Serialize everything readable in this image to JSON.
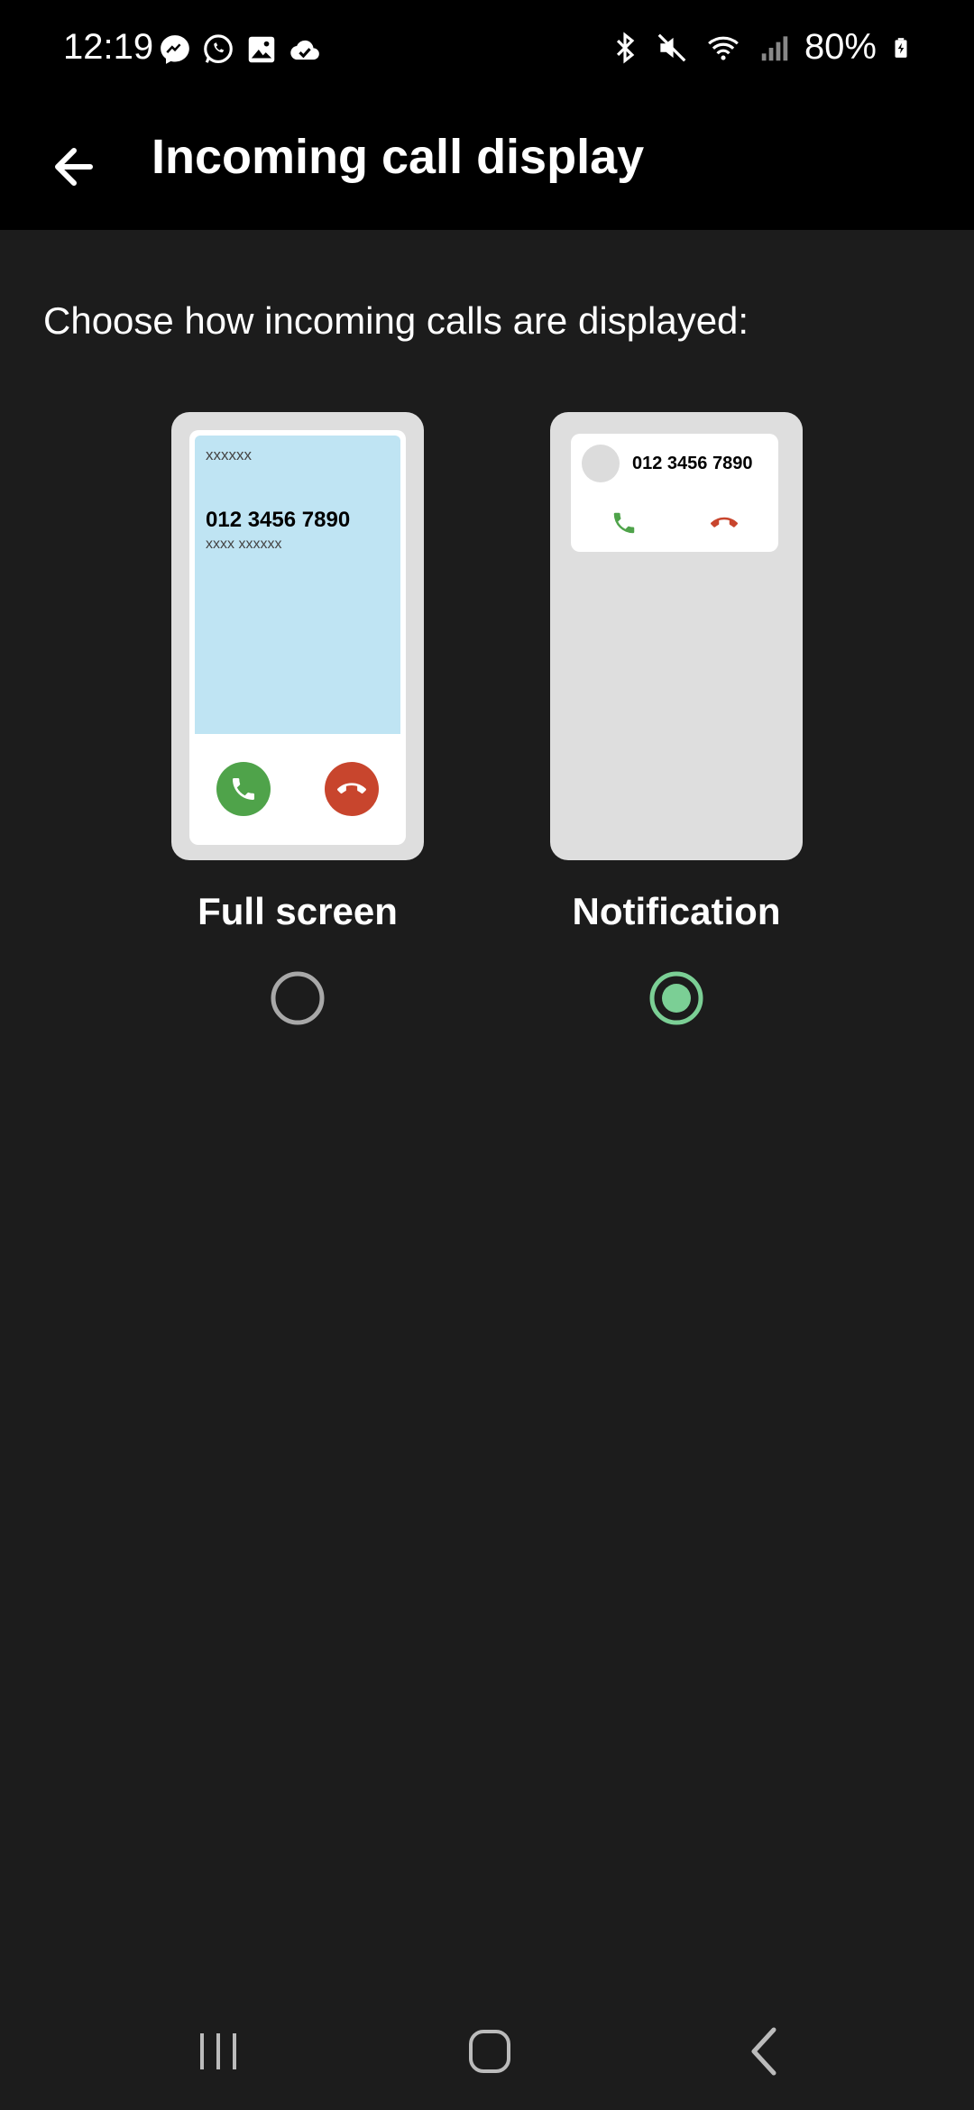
{
  "status_bar": {
    "time": "12:19",
    "battery": "80%",
    "left_icons": [
      "messenger-icon",
      "whatsapp-icon",
      "gallery-icon",
      "cloud-check-icon"
    ],
    "right_icons": [
      "bluetooth-icon",
      "mute-icon",
      "wifi-icon",
      "signal-icon",
      "battery-charging-icon"
    ]
  },
  "app_bar": {
    "title": "Incoming call display",
    "back_icon": "arrow-left-icon"
  },
  "subtitle": "Choose how incoming calls are displayed:",
  "options": [
    {
      "label": "Full screen",
      "selected": false,
      "preview": {
        "caller_name": "xxxxxx",
        "number": "012 3456 7890",
        "caller_label": "xxxx xxxxxx"
      }
    },
    {
      "label": "Notification",
      "selected": true,
      "preview": {
        "number": "012 3456 7890"
      }
    }
  ],
  "colors": {
    "background": "#1c1c1c",
    "accent_green": "#7bcf95",
    "accept_green": "#4fa34a",
    "decline_red": "#c8452d",
    "preview_blue": "#bfe4f3"
  },
  "nav_bar": {
    "buttons": [
      "recent-apps-icon",
      "home-icon",
      "back-icon"
    ]
  }
}
